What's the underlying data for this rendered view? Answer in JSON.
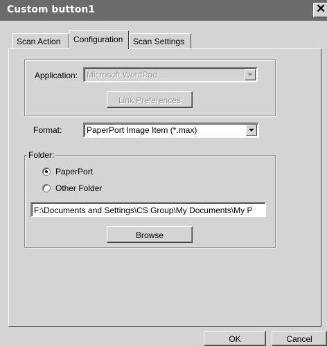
{
  "window": {
    "title": "Custom button1",
    "close_glyph": "✕"
  },
  "tabs": [
    {
      "label": "Scan Action",
      "active": false
    },
    {
      "label": "Configuration",
      "active": true
    },
    {
      "label": "Scan Settings",
      "active": false
    }
  ],
  "application": {
    "label": "Application:",
    "value": "Microsoft WordPad",
    "enabled": false,
    "link_preferences_label": "Link Preferences"
  },
  "format": {
    "label": "Format:",
    "value": "PaperPort Image Item (*.max)"
  },
  "folder": {
    "group_label": "Folder:",
    "options": [
      {
        "label": "PaperPort",
        "selected": true
      },
      {
        "label": "Other Folder",
        "selected": false
      }
    ],
    "path": "F:\\Documents and Settings\\CS Group\\My Documents\\My P",
    "browse_label": "Browse"
  },
  "footer": {
    "ok_label": "OK",
    "cancel_label": "Cancel"
  }
}
